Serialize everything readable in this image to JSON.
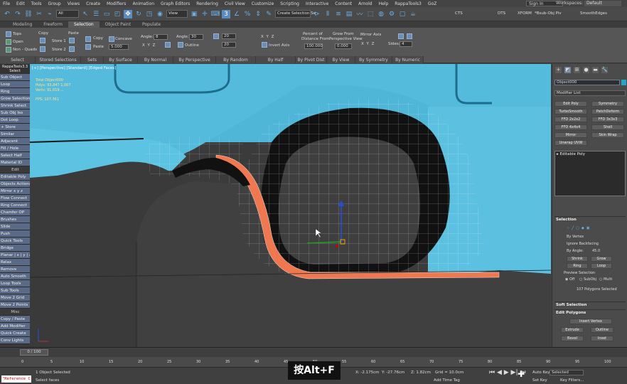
{
  "menu": [
    "File",
    "Edit",
    "Tools",
    "Group",
    "Views",
    "Create",
    "Modifiers",
    "Animation",
    "Graph Editors",
    "Rendering",
    "Civil View",
    "Customize",
    "Scripting",
    "Interactive",
    "Content",
    "Arnold",
    "Help",
    "RappaTools3",
    "GoZ"
  ],
  "signin": "Sign In",
  "workspace_label": "Workspaces:",
  "workspace_value": "Default",
  "toolbar": {
    "filter": "All",
    "view": "View",
    "selection_set": "Create Selection Se",
    "right_labels": [
      "CTS",
      "DTS",
      "XFORM",
      "*Bsub-Obj Piv",
      "SmoothEdges"
    ]
  },
  "ribbon_tabs": [
    "Modeling",
    "Freeform",
    "Selection",
    "Object Paint",
    "Populate"
  ],
  "ribbon_active_tab": "Selection",
  "ribbon": {
    "tops": "Tops",
    "open": "Open",
    "non_quads": "Non - Quads",
    "copy": "Copy",
    "paste": "Paste",
    "store1": "Store 1",
    "store2": "Store 2",
    "copy2": "Copy",
    "paste2": "Paste",
    "concave": "Concave",
    "concave_value": "5.000",
    "angle_label": "Angle:",
    "angle_value": "8",
    "angle2_label": "Angle:",
    "angle2_value": "30",
    "outline": "Outline",
    "invert_axis": "Invert Axis",
    "percent_label": "Percent of",
    "distance_label": "Distance From",
    "percent_value": "100.000",
    "grow_label": "Grow From",
    "perspective_label": "Perspective View",
    "grow_value": "0.000",
    "mirror_axis": "Mirror Axis",
    "sides_label": "Sides:",
    "sides_value": "4",
    "group_labels": [
      "Select",
      "Stored Selections",
      "Sets",
      "By Surface",
      "By Normal",
      "By Perspective",
      "By Random",
      "By Half",
      "By Pivot Dist",
      "By View",
      "By Symmetry",
      "By Numeric"
    ]
  },
  "leftpanel": {
    "title": "RappaTools3.3",
    "subtitle": "Select",
    "items": [
      "Sub Object",
      "Loop",
      "Ring",
      "Grow Selection",
      "Shrink Select",
      "Sub Obj Iso",
      "Dot Loop",
      "+ Store",
      "Similar",
      "Adjacent",
      "Fill / Hole",
      "Select Half",
      "Material ID",
      "Edit",
      "Editable Poly",
      "Objects Actions",
      "Mirror  x y z",
      "Flow Connect",
      "Ring Connect",
      "Chamfer OP",
      "Brushes",
      "Slide",
      "Push",
      "Quick Tools",
      "Bridge",
      "Planar | x | y | z",
      "Relax",
      "Remove",
      "Auto Smooth",
      "Loop Tools",
      "Sub Tools",
      "Move 2 Grid",
      "Move 2 Points",
      "Misc",
      "Copy / Paste",
      "Add Modifier",
      "Quick Create",
      "Conv Lights"
    ]
  },
  "viewport": {
    "label": "[+] [Perspective] [Standard] [Edged Faces]",
    "stats": [
      "Total       Object000",
      "Polys:  93,847       1,007",
      "Verts:   91,019          ...",
      "FPS:   107.361"
    ]
  },
  "cmdpanel": {
    "object_name": "Object000",
    "modifier_list": "Modifier List",
    "buttons": [
      "Edit Poly",
      "Symmetry",
      "TurboSmooth",
      "PatchDeform",
      "FFD 2x2x2",
      "FFD 3x3x3",
      "FFD 4x4x4",
      "Shell",
      "Mirror",
      "Skin Wrap",
      "Unwrap UVW"
    ],
    "stack_item": "Editable Poly",
    "selection_title": "Selection",
    "by_vertex": "By Vertex",
    "ignore_backfacing": "Ignore Backfacing",
    "by_angle": "By Angle:",
    "by_angle_value": "45.0",
    "shrink": "Shrink",
    "grow": "Grow",
    "ring": "Ring",
    "loop": "Loop",
    "preview_selection": "Preview Selection",
    "off": "Off",
    "subobj": "SubObj",
    "multi": "Multi",
    "selected_count": "107 Polygons Selected",
    "soft_selection": "Soft Selection",
    "edit_polygons": "Edit Polygons",
    "insert_vertex": "Insert Vertex",
    "extrude": "Extrude",
    "outline": "Outline",
    "bevel": "Bevel",
    "inset": "Inset"
  },
  "time_slider": "0 / 100",
  "ticks": [
    "0",
    "5",
    "10",
    "15",
    "20",
    "25",
    "30",
    "35",
    "40",
    "45",
    "50",
    "55",
    "60",
    "65",
    "70",
    "75",
    "80",
    "85",
    "90",
    "95",
    "100"
  ],
  "status": {
    "selected": "1 Object Selected",
    "hint": "Select faces",
    "x": "X: -2.175cm",
    "y": "Y: -27.76cm",
    "z": "Z: 1.82cm",
    "grid": "Grid = 10.0cm",
    "add_time_tag": "Add Time Tag",
    "auto_key": "Auto Key",
    "selected_dd": "Selected",
    "set_key": "Set Key",
    "key_filters": "Key Filters..."
  },
  "caption": "按Alt+F",
  "reference": "\"Reference C"
}
